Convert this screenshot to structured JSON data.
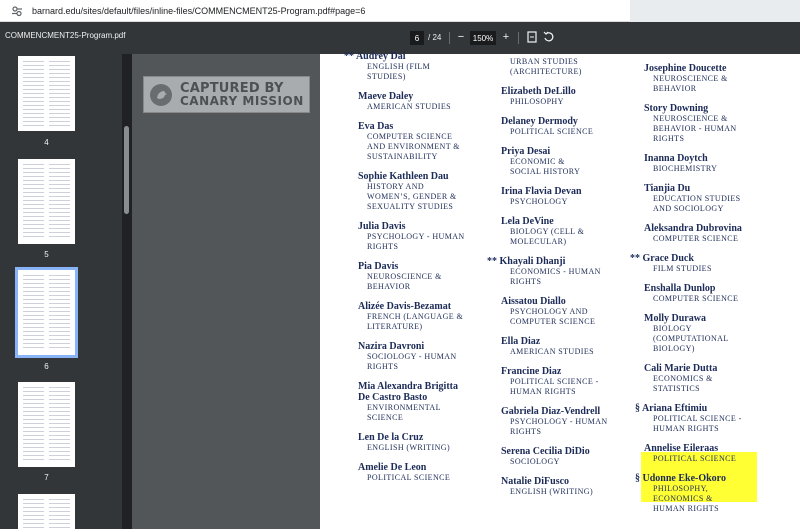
{
  "browser": {
    "url": "barnard.edu/sites/default/files/inline-files/COMMENCMENT25-Program.pdf#page=6"
  },
  "pdf_toolbar": {
    "filename": "COMMENCMENT25-Program.pdf",
    "current_page": "6",
    "total_pages": "/ 24",
    "zoom": "150%",
    "zoom_out": "−",
    "zoom_in": "+"
  },
  "thumbnails": [
    {
      "label": "4"
    },
    {
      "label": "5"
    },
    {
      "label": "6"
    },
    {
      "label": "7"
    }
  ],
  "watermark": {
    "line1": "CAPTURED BY",
    "line2": "CANARY MISSION"
  },
  "columns": [
    [
      {
        "mark": "**",
        "name": "Audrey Dai",
        "major": [
          "ENGLISH (FILM",
          "STUDIES)"
        ]
      },
      {
        "mark": "",
        "name": "Maeve Daley",
        "major": [
          "AMERICAN STUDIES"
        ]
      },
      {
        "mark": "",
        "name": "Eva Das",
        "major": [
          "COMPUTER SCIENCE",
          "AND ENVIRONMENT &",
          "SUSTAINABILITY"
        ]
      },
      {
        "mark": "",
        "name": "Sophie Kathleen Dau",
        "major": [
          "HISTORY AND",
          "WOMEN’S, GENDER &",
          "SEXUALITY STUDIES"
        ]
      },
      {
        "mark": "",
        "name": "Julia Davis",
        "major": [
          "PSYCHOLOGY - HUMAN",
          "RIGHTS"
        ]
      },
      {
        "mark": "",
        "name": "Pia Davis",
        "major": [
          "NEUROSCIENCE &",
          "BEHAVIOR"
        ]
      },
      {
        "mark": "",
        "name": "Alizée Davis-Bezamat",
        "major": [
          "FRENCH (LANGUAGE &",
          "LITERATURE)"
        ]
      },
      {
        "mark": "",
        "name": "Nazira Davroni",
        "major": [
          "SOCIOLOGY - HUMAN",
          "RIGHTS"
        ]
      },
      {
        "mark": "",
        "name": "Mia Alexandra Brigitta",
        "name2": "De Castro Basto",
        "major": [
          "ENVIRONMENTAL",
          "SCIENCE"
        ]
      },
      {
        "mark": "",
        "name": "Len De la Cruz",
        "major": [
          "ENGLISH (WRITING)"
        ]
      },
      {
        "mark": "",
        "name": "Amelie De Leon",
        "major": [
          "POLITICAL SCIENCE"
        ]
      }
    ],
    [
      {
        "mark": "",
        "name": "",
        "major": [
          "URBAN STUDIES",
          "(ARCHITECTURE)"
        ]
      },
      {
        "mark": "",
        "name": "Elizabeth DeLillo",
        "major": [
          "PHILOSOPHY"
        ]
      },
      {
        "mark": "",
        "name": "Delaney Dermody",
        "major": [
          "POLITICAL SCIENCE"
        ]
      },
      {
        "mark": "",
        "name": "Priya Desai",
        "major": [
          "ECONOMIC &",
          "SOCIAL HISTORY"
        ]
      },
      {
        "mark": "",
        "name": "Irina Flavia Devan",
        "major": [
          "PSYCHOLOGY"
        ]
      },
      {
        "mark": "",
        "name": "Lela DeVine",
        "major": [
          "BIOLOGY (CELL &",
          "MOLECULAR)"
        ]
      },
      {
        "mark": "**",
        "name": "Khayali Dhanji",
        "major": [
          "ECONOMICS - HUMAN",
          "RIGHTS"
        ]
      },
      {
        "mark": "",
        "name": "Aissatou Diallo",
        "major": [
          "PSYCHOLOGY AND",
          "COMPUTER SCIENCE"
        ]
      },
      {
        "mark": "",
        "name": "Ella Diaz",
        "major": [
          "AMERICAN STUDIES"
        ]
      },
      {
        "mark": "",
        "name": "Francine Diaz",
        "major": [
          "POLITICAL SCIENCE -",
          "HUMAN RIGHTS"
        ]
      },
      {
        "mark": "",
        "name": "Gabriela Diaz-Vendrell",
        "major": [
          "PSYCHOLOGY - HUMAN",
          "RIGHTS"
        ]
      },
      {
        "mark": "",
        "name": "Serena Cecilia DiDio",
        "major": [
          "SOCIOLOGY"
        ]
      },
      {
        "mark": "",
        "name": "Natalie DiFusco",
        "major": [
          "ENGLISH (WRITING)"
        ]
      }
    ],
    [
      {
        "mark": "",
        "name": "Josephine Doucette",
        "major": [
          "NEUROSCIENCE &",
          "BEHAVIOR"
        ]
      },
      {
        "mark": "",
        "name": "Story Downing",
        "major": [
          "NEUROSCIENCE &",
          "BEHAVIOR - HUMAN",
          "RIGHTS"
        ]
      },
      {
        "mark": "",
        "name": "Inanna Doytch",
        "major": [
          "BIOCHEMISTRY"
        ]
      },
      {
        "mark": "",
        "name": "Tianjia Du",
        "major": [
          "EDUCATION STUDIES",
          "AND SOCIOLOGY"
        ]
      },
      {
        "mark": "",
        "name": "Aleksandra Dubrovina",
        "major": [
          "COMPUTER SCIENCE"
        ]
      },
      {
        "mark": "**",
        "name": "Grace Duck",
        "major": [
          "FILM STUDIES"
        ]
      },
      {
        "mark": "",
        "name": "Enshalla Dunlop",
        "major": [
          "COMPUTER SCIENCE"
        ]
      },
      {
        "mark": "",
        "name": "Molly Durawa",
        "major": [
          "BIOLOGY",
          "(COMPUTATIONAL",
          "BIOLOGY)"
        ]
      },
      {
        "mark": "",
        "name": "Cali Marie Dutta",
        "major": [
          "ECONOMICS &",
          "STATISTICS"
        ]
      },
      {
        "mark": "§",
        "name": "Ariana Eftimiu",
        "major": [
          "POLITICAL SCIENCE -",
          "HUMAN RIGHTS"
        ]
      },
      {
        "mark": "",
        "name": "Annelise Eileraas",
        "major": [
          "POLITICAL SCIENCE"
        ]
      },
      {
        "mark": "§",
        "name": "Udonne Eke-Okoro",
        "major": [
          "PHILOSOPHY,",
          "ECONOMICS &",
          "HUMAN RIGHTS"
        ]
      }
    ]
  ],
  "colors": {
    "ink": "#1c2b57",
    "highlight": "#ffff33"
  }
}
